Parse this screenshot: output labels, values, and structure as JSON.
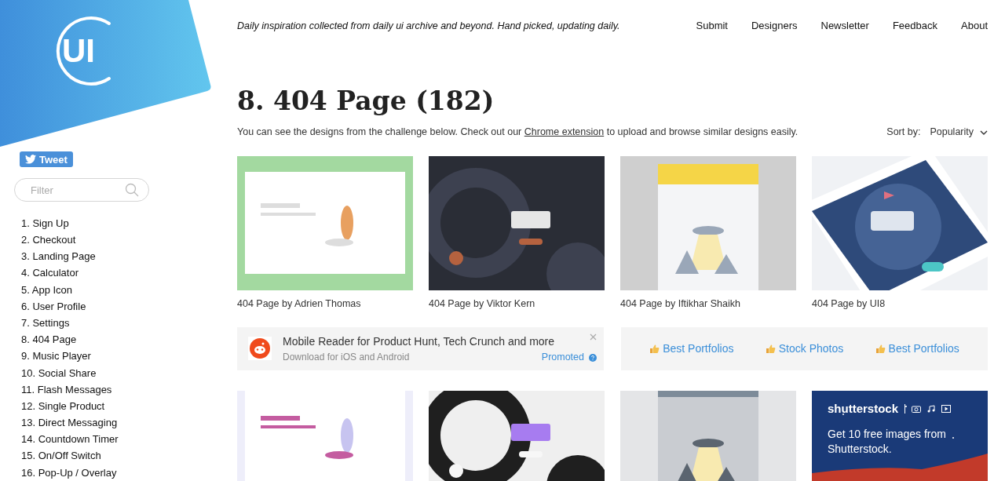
{
  "logo": {
    "text": "UI"
  },
  "tweet_button": {
    "label": "Tweet"
  },
  "filter": {
    "placeholder": "Filter"
  },
  "sidebar": {
    "items": [
      {
        "label": "1. Sign Up"
      },
      {
        "label": "2. Checkout"
      },
      {
        "label": "3. Landing Page"
      },
      {
        "label": "4. Calculator"
      },
      {
        "label": "5. App Icon"
      },
      {
        "label": "6. User Profile"
      },
      {
        "label": "7. Settings"
      },
      {
        "label": "8. 404 Page"
      },
      {
        "label": "9. Music Player"
      },
      {
        "label": "10. Social Share"
      },
      {
        "label": "11. Flash Messages"
      },
      {
        "label": "12. Single Product"
      },
      {
        "label": "13. Direct Messaging"
      },
      {
        "label": "14. Countdown Timer"
      },
      {
        "label": "15. On/Off Switch"
      },
      {
        "label": "16. Pop-Up / Overlay"
      }
    ]
  },
  "tagline": "Daily inspiration collected from daily ui archive and beyond. Hand picked, updating daily.",
  "nav": [
    "Submit",
    "Designers",
    "Newsletter",
    "Feedback",
    "About"
  ],
  "title": "8. 404 Page (182)",
  "intro": {
    "before": "You can see the designs from the challenge below. Check out our ",
    "link": "Chrome extension",
    "after": " to upload and browse similar designs easily."
  },
  "sort": {
    "label": "Sort by:",
    "value": "Popularity"
  },
  "designs": [
    {
      "caption": "404 Page by Adrien Thomas",
      "kind": "picture"
    },
    {
      "caption": "404 Page by Viktor Kern",
      "kind": "picture"
    },
    {
      "caption": "404 Page by Iftikhar Shaikh",
      "kind": "picture"
    },
    {
      "caption": "404 Page by UI8",
      "kind": "picture"
    }
  ],
  "ad": {
    "title": "Mobile Reader for Product Hunt, Tech Crunch and more",
    "subtitle": "Download for iOS and Android",
    "promoted": "Promoted"
  },
  "promo_links": [
    "Best Portfolios",
    "Stock Photos",
    "Best Portfolios"
  ],
  "more_designs": [
    {
      "kind": "picture"
    },
    {
      "kind": "picture"
    },
    {
      "kind": "picture"
    },
    {
      "kind": "banner",
      "brand": "shutterstock",
      "headline": "Get 10 free images from Shutterstock."
    }
  ]
}
